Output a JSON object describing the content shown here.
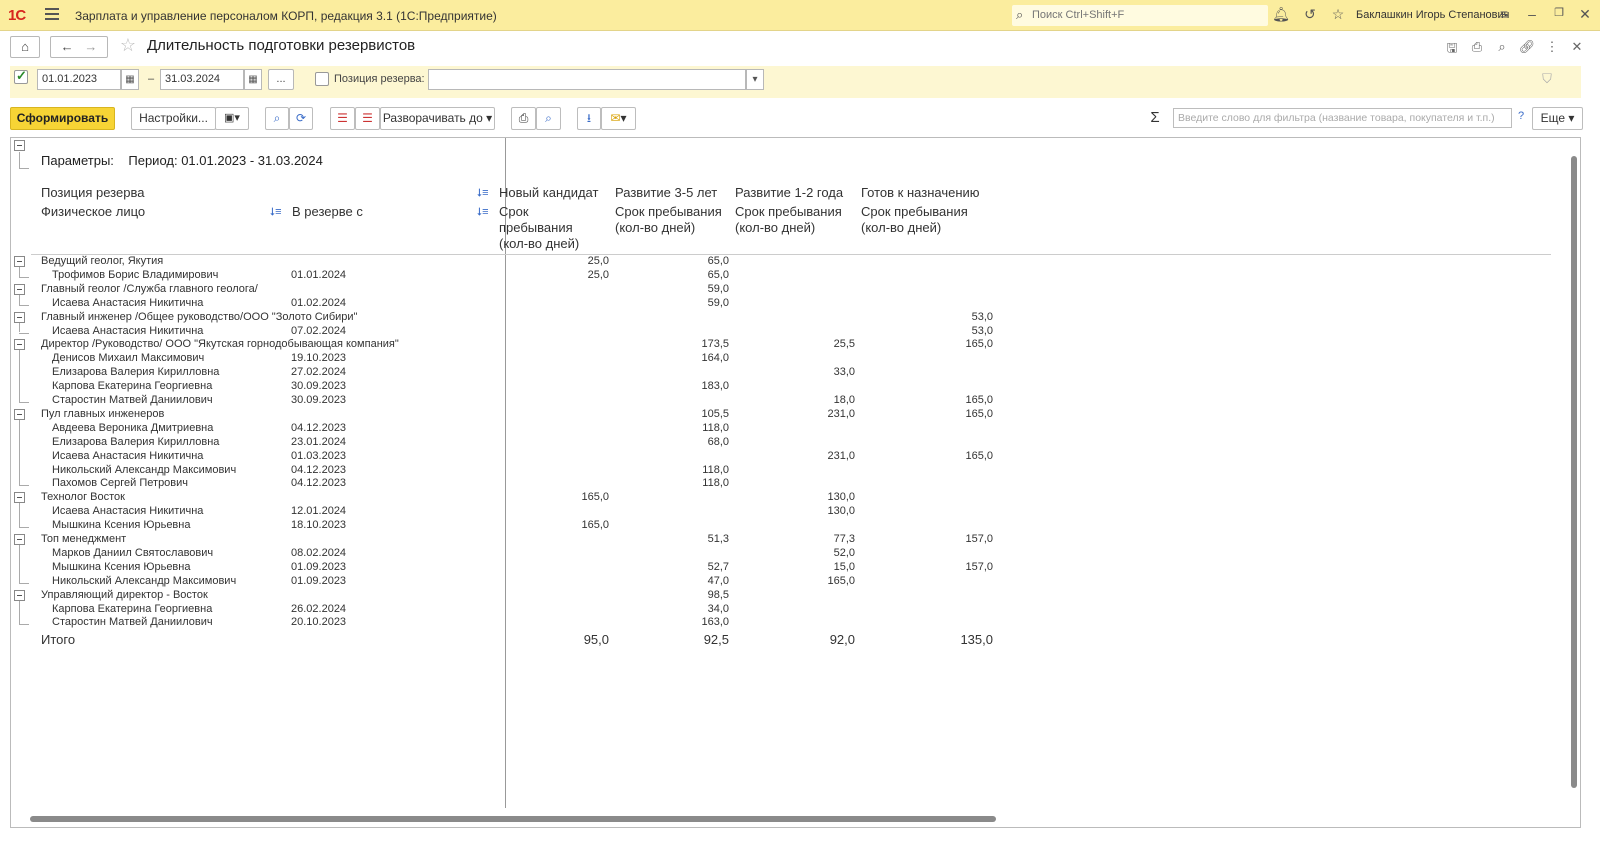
{
  "titlebar": {
    "logo": "1С",
    "app_title": "Зарплата и управление персоналом КОРП, редакция 3.1  (1С:Предприятие)",
    "search_placeholder": "Поиск Ctrl+Shift+F",
    "user": "Баклашкин Игорь Степанович"
  },
  "form": {
    "title": "Длительность подготовки резервистов"
  },
  "filter": {
    "date_from": "01.01.2023",
    "date_to": "31.03.2024",
    "dash": "–",
    "more_btn": "...",
    "position_label": "Позиция резерва:",
    "position_value": ""
  },
  "cmd": {
    "generate": "Сформировать",
    "settings": "Настройки...",
    "expand_to": "Разворачивать до",
    "filter_placeholder": "Введите слово для фильтра (название товара, покупателя и т.п.)",
    "help": "?",
    "more": "Еще"
  },
  "report": {
    "params_label": "Параметры:",
    "params_value": "Период: 01.01.2023 - 31.03.2024",
    "hdr_position": "Позиция резерва",
    "hdr_person": "Физическое лицо",
    "hdr_since": "В резерве с",
    "columns": [
      {
        "title": "Новый кандидат",
        "sub1": "Срок",
        "sub2": "пребывания",
        "sub3": "(кол-во дней)"
      },
      {
        "title": "Развитие 3-5 лет",
        "sub1": "Срок пребывания",
        "sub2": "(кол-во дней)",
        "sub3": ""
      },
      {
        "title": "Развитие 1-2 года",
        "sub1": "Срок пребывания",
        "sub2": "(кол-во дней)",
        "sub3": ""
      },
      {
        "title": "Готов к назначению",
        "sub1": "Срок пребывания",
        "sub2": "(кол-во дней)",
        "sub3": ""
      }
    ],
    "rows": [
      {
        "level": 0,
        "name": "Ведущий геолог, Якутия",
        "date": "",
        "v": [
          "25,0",
          "65,0",
          "",
          ""
        ]
      },
      {
        "level": 1,
        "name": "Трофимов Борис Владимирович",
        "date": "01.01.2024",
        "v": [
          "25,0",
          "65,0",
          "",
          ""
        ]
      },
      {
        "level": 0,
        "name": "Главный геолог /Служба главного геолога/",
        "date": "",
        "v": [
          "",
          "59,0",
          "",
          ""
        ]
      },
      {
        "level": 1,
        "name": "Исаева Анастасия Никитична",
        "date": "01.02.2024",
        "v": [
          "",
          "59,0",
          "",
          ""
        ]
      },
      {
        "level": 0,
        "name": "Главный инженер /Общее руководство/ООО \"Золото Сибири\"",
        "date": "",
        "v": [
          "",
          "",
          "",
          "53,0"
        ]
      },
      {
        "level": 1,
        "name": "Исаева Анастасия Никитична",
        "date": "07.02.2024",
        "v": [
          "",
          "",
          "",
          "53,0"
        ]
      },
      {
        "level": 0,
        "name": "Директор /Руководство/ ООО \"Якутская горнодобывающая компания\"",
        "date": "",
        "v": [
          "",
          "173,5",
          "25,5",
          "165,0"
        ]
      },
      {
        "level": 1,
        "name": "Денисов Михаил Максимович",
        "date": "19.10.2023",
        "v": [
          "",
          "164,0",
          "",
          ""
        ]
      },
      {
        "level": 1,
        "name": "Елизарова Валерия Кирилловна",
        "date": "27.02.2024",
        "v": [
          "",
          "",
          "33,0",
          ""
        ]
      },
      {
        "level": 1,
        "name": "Карпова Екатерина Георгиевна",
        "date": "30.09.2023",
        "v": [
          "",
          "183,0",
          "",
          ""
        ]
      },
      {
        "level": 1,
        "name": "Старостин Матвей Даниилович",
        "date": "30.09.2023",
        "v": [
          "",
          "",
          "18,0",
          "165,0"
        ]
      },
      {
        "level": 0,
        "name": "Пул главных инженеров",
        "date": "",
        "v": [
          "",
          "105,5",
          "231,0",
          "165,0"
        ]
      },
      {
        "level": 1,
        "name": "Авдеева Вероника Дмитриевна",
        "date": "04.12.2023",
        "v": [
          "",
          "118,0",
          "",
          ""
        ]
      },
      {
        "level": 1,
        "name": "Елизарова Валерия Кирилловна",
        "date": "23.01.2024",
        "v": [
          "",
          "68,0",
          "",
          ""
        ]
      },
      {
        "level": 1,
        "name": "Исаева Анастасия Никитична",
        "date": "01.03.2023",
        "v": [
          "",
          "",
          "231,0",
          "165,0"
        ]
      },
      {
        "level": 1,
        "name": "Никольский Александр Максимович",
        "date": "04.12.2023",
        "v": [
          "",
          "118,0",
          "",
          ""
        ]
      },
      {
        "level": 1,
        "name": "Пахомов Сергей Петрович",
        "date": "04.12.2023",
        "v": [
          "",
          "118,0",
          "",
          ""
        ]
      },
      {
        "level": 0,
        "name": "Технолог Восток",
        "date": "",
        "v": [
          "165,0",
          "",
          "130,0",
          ""
        ]
      },
      {
        "level": 1,
        "name": "Исаева Анастасия Никитична",
        "date": "12.01.2024",
        "v": [
          "",
          "",
          "130,0",
          ""
        ]
      },
      {
        "level": 1,
        "name": "Мышкина Ксения Юрьевна",
        "date": "18.10.2023",
        "v": [
          "165,0",
          "",
          "",
          ""
        ]
      },
      {
        "level": 0,
        "name": "Топ менеджмент",
        "date": "",
        "v": [
          "",
          "51,3",
          "77,3",
          "157,0"
        ]
      },
      {
        "level": 1,
        "name": "Марков Даниил Святославович",
        "date": "08.02.2024",
        "v": [
          "",
          "",
          "52,0",
          ""
        ]
      },
      {
        "level": 1,
        "name": "Мышкина Ксения Юрьевна",
        "date": "01.09.2023",
        "v": [
          "",
          "52,7",
          "15,0",
          "157,0"
        ]
      },
      {
        "level": 1,
        "name": "Никольский Александр Максимович",
        "date": "01.09.2023",
        "v": [
          "",
          "47,0",
          "165,0",
          ""
        ]
      },
      {
        "level": 0,
        "name": "Управляющий директор - Восток",
        "date": "",
        "v": [
          "",
          "98,5",
          "",
          ""
        ]
      },
      {
        "level": 1,
        "name": "Карпова Екатерина Георгиевна",
        "date": "26.02.2024",
        "v": [
          "",
          "34,0",
          "",
          ""
        ]
      },
      {
        "level": 1,
        "name": "Старостин Матвей Даниилович",
        "date": "20.10.2023",
        "v": [
          "",
          "163,0",
          "",
          ""
        ]
      }
    ],
    "total": {
      "label": "Итого",
      "v": [
        "95,0",
        "92,5",
        "92,0",
        "135,0"
      ]
    }
  }
}
